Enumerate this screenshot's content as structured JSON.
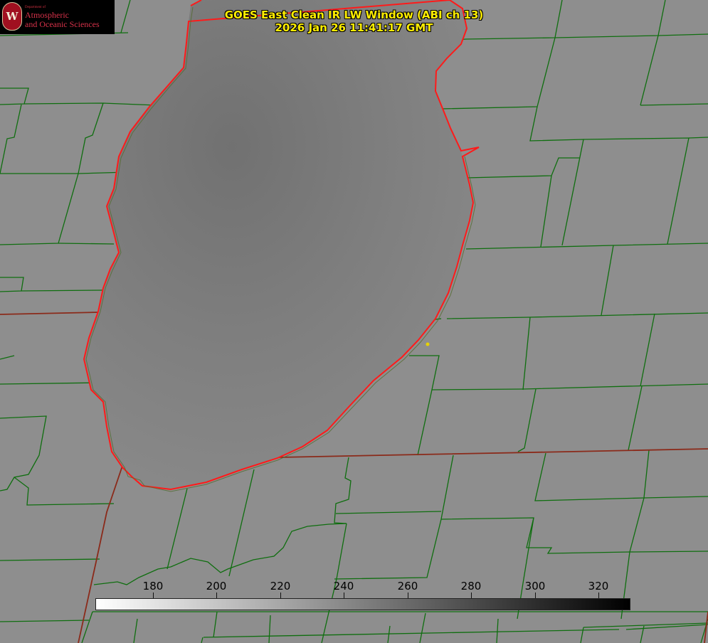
{
  "title": {
    "line1": "GOES East Clean IR LW Window (ABI ch 13)",
    "line2": "2026 Jan 26 11:41:17 GMT"
  },
  "logo": {
    "dept": "Department of",
    "line1": "Atmospheric",
    "line2": "and Oceanic Sciences",
    "seal_letter": "W"
  },
  "colorbar": {
    "ticks": [
      "180",
      "200",
      "220",
      "240",
      "260",
      "280",
      "300",
      "320"
    ],
    "min": 162,
    "max": 330,
    "start_color": "#ffffff",
    "end_color": "#000000"
  },
  "colors": {
    "land": "#8e8e8e",
    "lake": "#7e7e7e",
    "county_lines": "#0f6e0f",
    "state_lines": "#8b2a1a",
    "coastline": "#ff1a1a",
    "marker": "#e6d200",
    "title_text": "#ffee00"
  }
}
